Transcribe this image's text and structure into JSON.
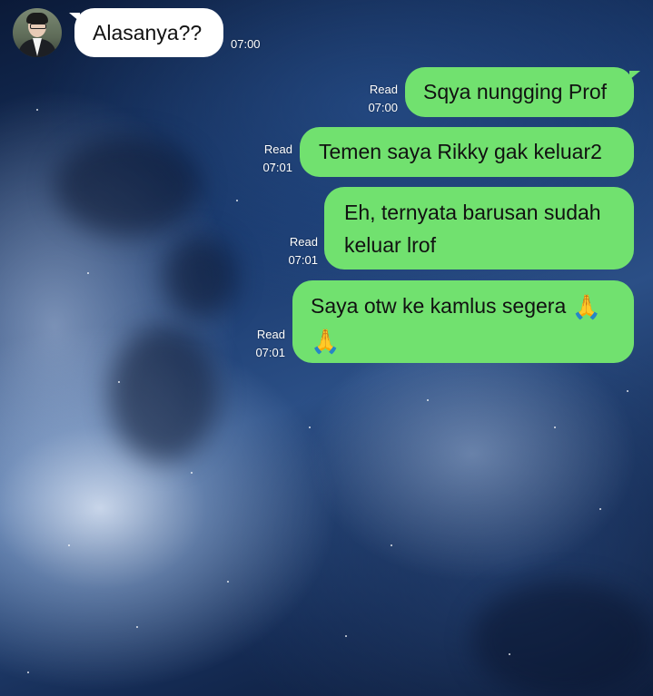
{
  "contact": {
    "avatar_icon": "person-avatar-icon"
  },
  "messages": [
    {
      "id": "m1",
      "direction": "incoming",
      "text": "Alasanya??",
      "time": "07:00"
    },
    {
      "id": "m2",
      "direction": "outgoing",
      "text": "Sqya nungging Prof",
      "status": "Read",
      "time": "07:00"
    },
    {
      "id": "m3",
      "direction": "outgoing",
      "text": "Temen saya Rikky gak keluar2",
      "status": "Read",
      "time": "07:01"
    },
    {
      "id": "m4",
      "direction": "outgoing",
      "lines": [
        "Eh, ternyata barusan sudah",
        "keluar lrof"
      ],
      "status": "Read",
      "time": "07:01"
    },
    {
      "id": "m5",
      "direction": "outgoing",
      "text": "Saya otw ke kamlus segera",
      "emoji": "🙏",
      "emoji_icon": "folded-hands-icon",
      "status": "Read",
      "time": "07:01"
    }
  ],
  "colors": {
    "outgoing_bubble": "#71e16f",
    "incoming_bubble": "#ffffff",
    "meta_text": "#ffffff"
  }
}
